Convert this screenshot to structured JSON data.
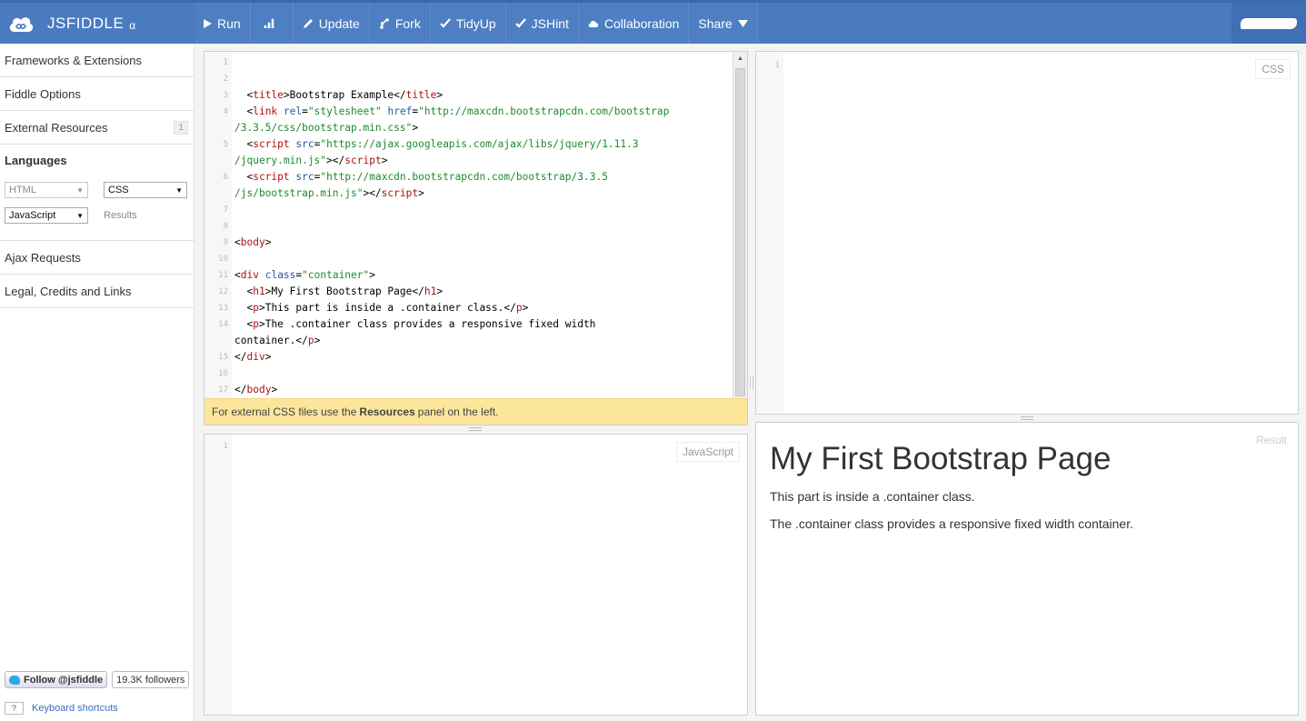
{
  "brand": {
    "name": "JSFIDDLE",
    "version": "α"
  },
  "toolbar": {
    "run": "Run",
    "update": "Update",
    "fork": "Fork",
    "tidyup": "TidyUp",
    "jshint": "JSHint",
    "collaboration": "Collaboration",
    "share": "Share"
  },
  "sidebar": {
    "frameworks": "Frameworks & Extensions",
    "fiddle_options": "Fiddle Options",
    "external_resources": "External Resources",
    "external_resources_count": "1",
    "languages_title": "Languages",
    "html_select": "HTML",
    "css_select": "CSS",
    "js_select": "JavaScript",
    "results_label": "Results",
    "ajax": "Ajax Requests",
    "legal": "Legal, Credits and Links",
    "follow": "Follow @jsfiddle",
    "followers": "19.3K followers",
    "kbd_icon": "?",
    "kbd_link": "Keyboard shortcuts"
  },
  "html_panel": {
    "line_numbers": [
      "1",
      "2",
      "3",
      "4",
      "5",
      "6",
      "7",
      "8",
      "9",
      "10",
      "11",
      "12",
      "13",
      "14",
      "15",
      "16",
      "17"
    ],
    "notice_pre": "For external CSS files use the ",
    "notice_bold": "Resources",
    "notice_post": " panel on the left."
  },
  "css_panel": {
    "label": "CSS",
    "line": "1"
  },
  "js_panel": {
    "label": "JavaScript",
    "line": "1"
  },
  "result_panel": {
    "label": "Result",
    "heading": "My First Bootstrap Page",
    "p1": "This part is inside a .container class.",
    "p2": "The .container class provides a responsive fixed width container."
  },
  "icons": [
    "play-icon",
    "chart-icon",
    "pencil-icon",
    "fork-icon",
    "check-icon",
    "cloud-icon",
    "chevron-down-icon",
    "jsfiddle-logo-icon",
    "twitter-bird-icon"
  ],
  "colors": {
    "topbar": "#4a7bc0",
    "notice": "#fbe69c",
    "tag": "#a11",
    "attr": "#2658a8",
    "string": "#1d8a2d"
  }
}
